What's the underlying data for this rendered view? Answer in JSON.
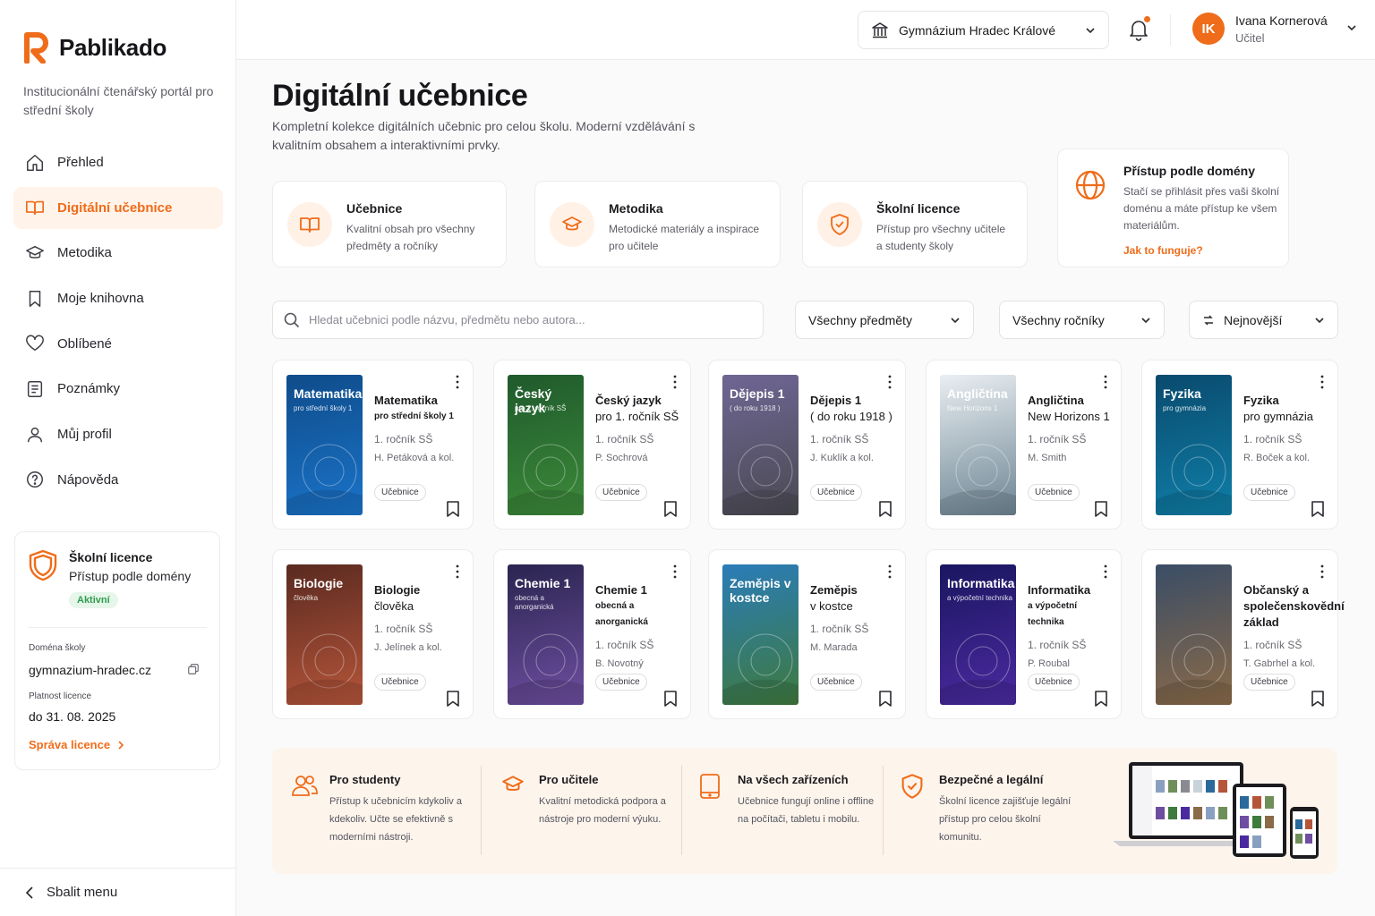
{
  "brand": {
    "name": "Pablikado",
    "tagline": "Institucionální čtenářský portál pro střední školy",
    "accent": "#ef6c1a"
  },
  "nav": [
    {
      "label": "Přehled",
      "icon": "home-icon",
      "active": false
    },
    {
      "label": "Digitální učebnice",
      "icon": "book-open-icon",
      "active": true
    },
    {
      "label": "Metodika",
      "icon": "graduation-cap-icon",
      "active": false
    },
    {
      "label": "Moje knihovna",
      "icon": "bookmark-icon",
      "active": false
    },
    {
      "label": "Oblíbené",
      "icon": "heart-icon",
      "active": false
    },
    {
      "label": "Poznámky",
      "icon": "notes-icon",
      "active": false
    },
    {
      "label": "Můj profil",
      "icon": "user-icon",
      "active": false
    },
    {
      "label": "Nápověda",
      "icon": "help-icon",
      "active": false
    }
  ],
  "license": {
    "title": "Školní licence",
    "subtitle": "Přístup podle domény",
    "status": "Aktivní",
    "domain_label": "Doména školy",
    "domain": "gymnazium-hradec.cz",
    "valid_label": "Platnost licence",
    "valid": "do 31. 08. 2025",
    "manage": "Správa licence"
  },
  "collapse_label": "Sbalit menu",
  "topbar": {
    "school": "Gymnázium Hradec Králové",
    "user": {
      "initials": "IK",
      "name": "Ivana Kornerová",
      "role": "Učitel"
    }
  },
  "page": {
    "title": "Digitální učebnice",
    "description": "Kompletní kolekce digitálních učebnic pro celou školu. Moderní vzdělávání s kvalitním obsahem a interaktivními prvky."
  },
  "features": [
    {
      "title": "Učebnice",
      "text": "Kvalitní obsah pro všechny předměty a ročníky",
      "icon": "book-open-icon"
    },
    {
      "title": "Metodika",
      "text": "Metodické materiály a inspirace pro učitele",
      "icon": "graduation-cap-icon"
    },
    {
      "title": "Školní licence",
      "text": "Přístup pro všechny učitele a studenty školy",
      "icon": "shield-check-icon"
    }
  ],
  "domain_access": {
    "title": "Přístup podle domény",
    "text": "Stačí se přihlásit přes vaši školní doménu a máte přístup ke všem materiálům.",
    "link": "Jak to funguje?",
    "icon": "globe-icon"
  },
  "filters": {
    "search_placeholder": "Hledat učebnici podle názvu, předmětu nebo autora...",
    "subject": "Všechny předměty",
    "grade": "Všechny ročníky",
    "sort": "Nejnovější"
  },
  "books": [
    {
      "title": "Matematika",
      "subtitle": "pro střední školy 1",
      "grade": "1. ročník SŠ",
      "author": "H. Petáková a kol.",
      "badge": "Učebnice",
      "cover_title": "Matematika",
      "cover_sub": "pro střední školy 1",
      "colors": [
        "#0f4c8a",
        "#1a73c9"
      ]
    },
    {
      "title": "Český jazyk",
      "subtitle": "pro 1. ročník SŠ",
      "grade": "1. ročník SŠ",
      "author": "P. Sochrová",
      "badge": "Učebnice",
      "cover_title": "Český jazyk",
      "cover_sub": "pro 1. ročník SŠ",
      "colors": [
        "#1f5a2c",
        "#3d8a3a"
      ]
    },
    {
      "title": "Dějepis 1",
      "subtitle": "( do roku 1918 )",
      "grade": "1. ročník SŠ",
      "author": "J. Kuklík a kol.",
      "badge": "Učebnice",
      "cover_title": "Dějepis 1",
      "cover_sub": "( do roku 1918 )",
      "colors": [
        "#6f6694",
        "#4a4a52"
      ]
    },
    {
      "title": "Angličtina",
      "subtitle": "New Horizons 1",
      "grade": "1. ročník SŠ",
      "author": "M. Smith",
      "badge": "Učebnice",
      "cover_title": "Angličtina",
      "cover_sub": "New Horizons 1",
      "colors": [
        "#e9eef2",
        "#6d8593"
      ]
    },
    {
      "title": "Fyzika",
      "subtitle": "pro gymnázia",
      "grade": "1. ročník SŠ",
      "author": "R. Boček a kol.",
      "badge": "Učebnice",
      "cover_title": "Fyzika",
      "cover_sub": "pro gymnázia",
      "colors": [
        "#0a4a6e",
        "#0f7fa8"
      ]
    },
    {
      "title": "Biologie",
      "subtitle": "člověka",
      "grade": "1. ročník SŠ",
      "author": "J. Jelínek a kol.",
      "badge": "Učebnice",
      "cover_title": "Biologie",
      "cover_sub": "člověka",
      "colors": [
        "#5a2a20",
        "#b5553a"
      ]
    },
    {
      "title": "Chemie 1",
      "subtitle": "obecná a anorganická",
      "grade": "1. ročník SŠ",
      "author": "B. Novotný",
      "badge": "Učebnice",
      "cover_title": "Chemie 1",
      "cover_sub": "obecná a anorganická",
      "colors": [
        "#2a2550",
        "#6e4ea0"
      ]
    },
    {
      "title": "Zeměpis",
      "subtitle": "v kostce",
      "grade": "1. ročník SŠ",
      "author": "M. Marada",
      "badge": "Učebnice",
      "cover_title": "Zeměpis v kostce",
      "cover_sub": "",
      "colors": [
        "#2a7cb8",
        "#3f7a3e"
      ]
    },
    {
      "title": "Informatika",
      "subtitle": "a výpočetní technika",
      "grade": "1. ročník SŠ",
      "author": "P. Roubal",
      "badge": "Učebnice",
      "cover_title": "Informatika",
      "cover_sub": "a výpočetní technika",
      "colors": [
        "#1a1660",
        "#4b2aa0"
      ]
    },
    {
      "title": "Občanský a společenskovědní základ",
      "subtitle": "",
      "grade": "1. ročník SŠ",
      "author": "T. Gabrhel a kol.",
      "badge": "Učebnice",
      "cover_title": "",
      "cover_sub": "",
      "colors": [
        "#3a4d66",
        "#8a6a48"
      ]
    }
  ],
  "benefits": [
    {
      "title": "Pro studenty",
      "text": "Přístup k učebnicím kdykoliv a kdekoliv. Učte se efektivně s moderními nástroji.",
      "icon": "users-icon"
    },
    {
      "title": "Pro učitele",
      "text": "Kvalitní metodická podpora a nástroje pro moderní výuku.",
      "icon": "graduation-cap-icon"
    },
    {
      "title": "Na všech zařízeních",
      "text": "Učebnice fungují online i offline na počítači, tabletu i mobilu.",
      "icon": "tablet-icon"
    },
    {
      "title": "Bezpečné a legální",
      "text": "Školní licence zajišťuje legální přístup pro celou školní komunitu.",
      "icon": "shield-check-icon"
    }
  ]
}
